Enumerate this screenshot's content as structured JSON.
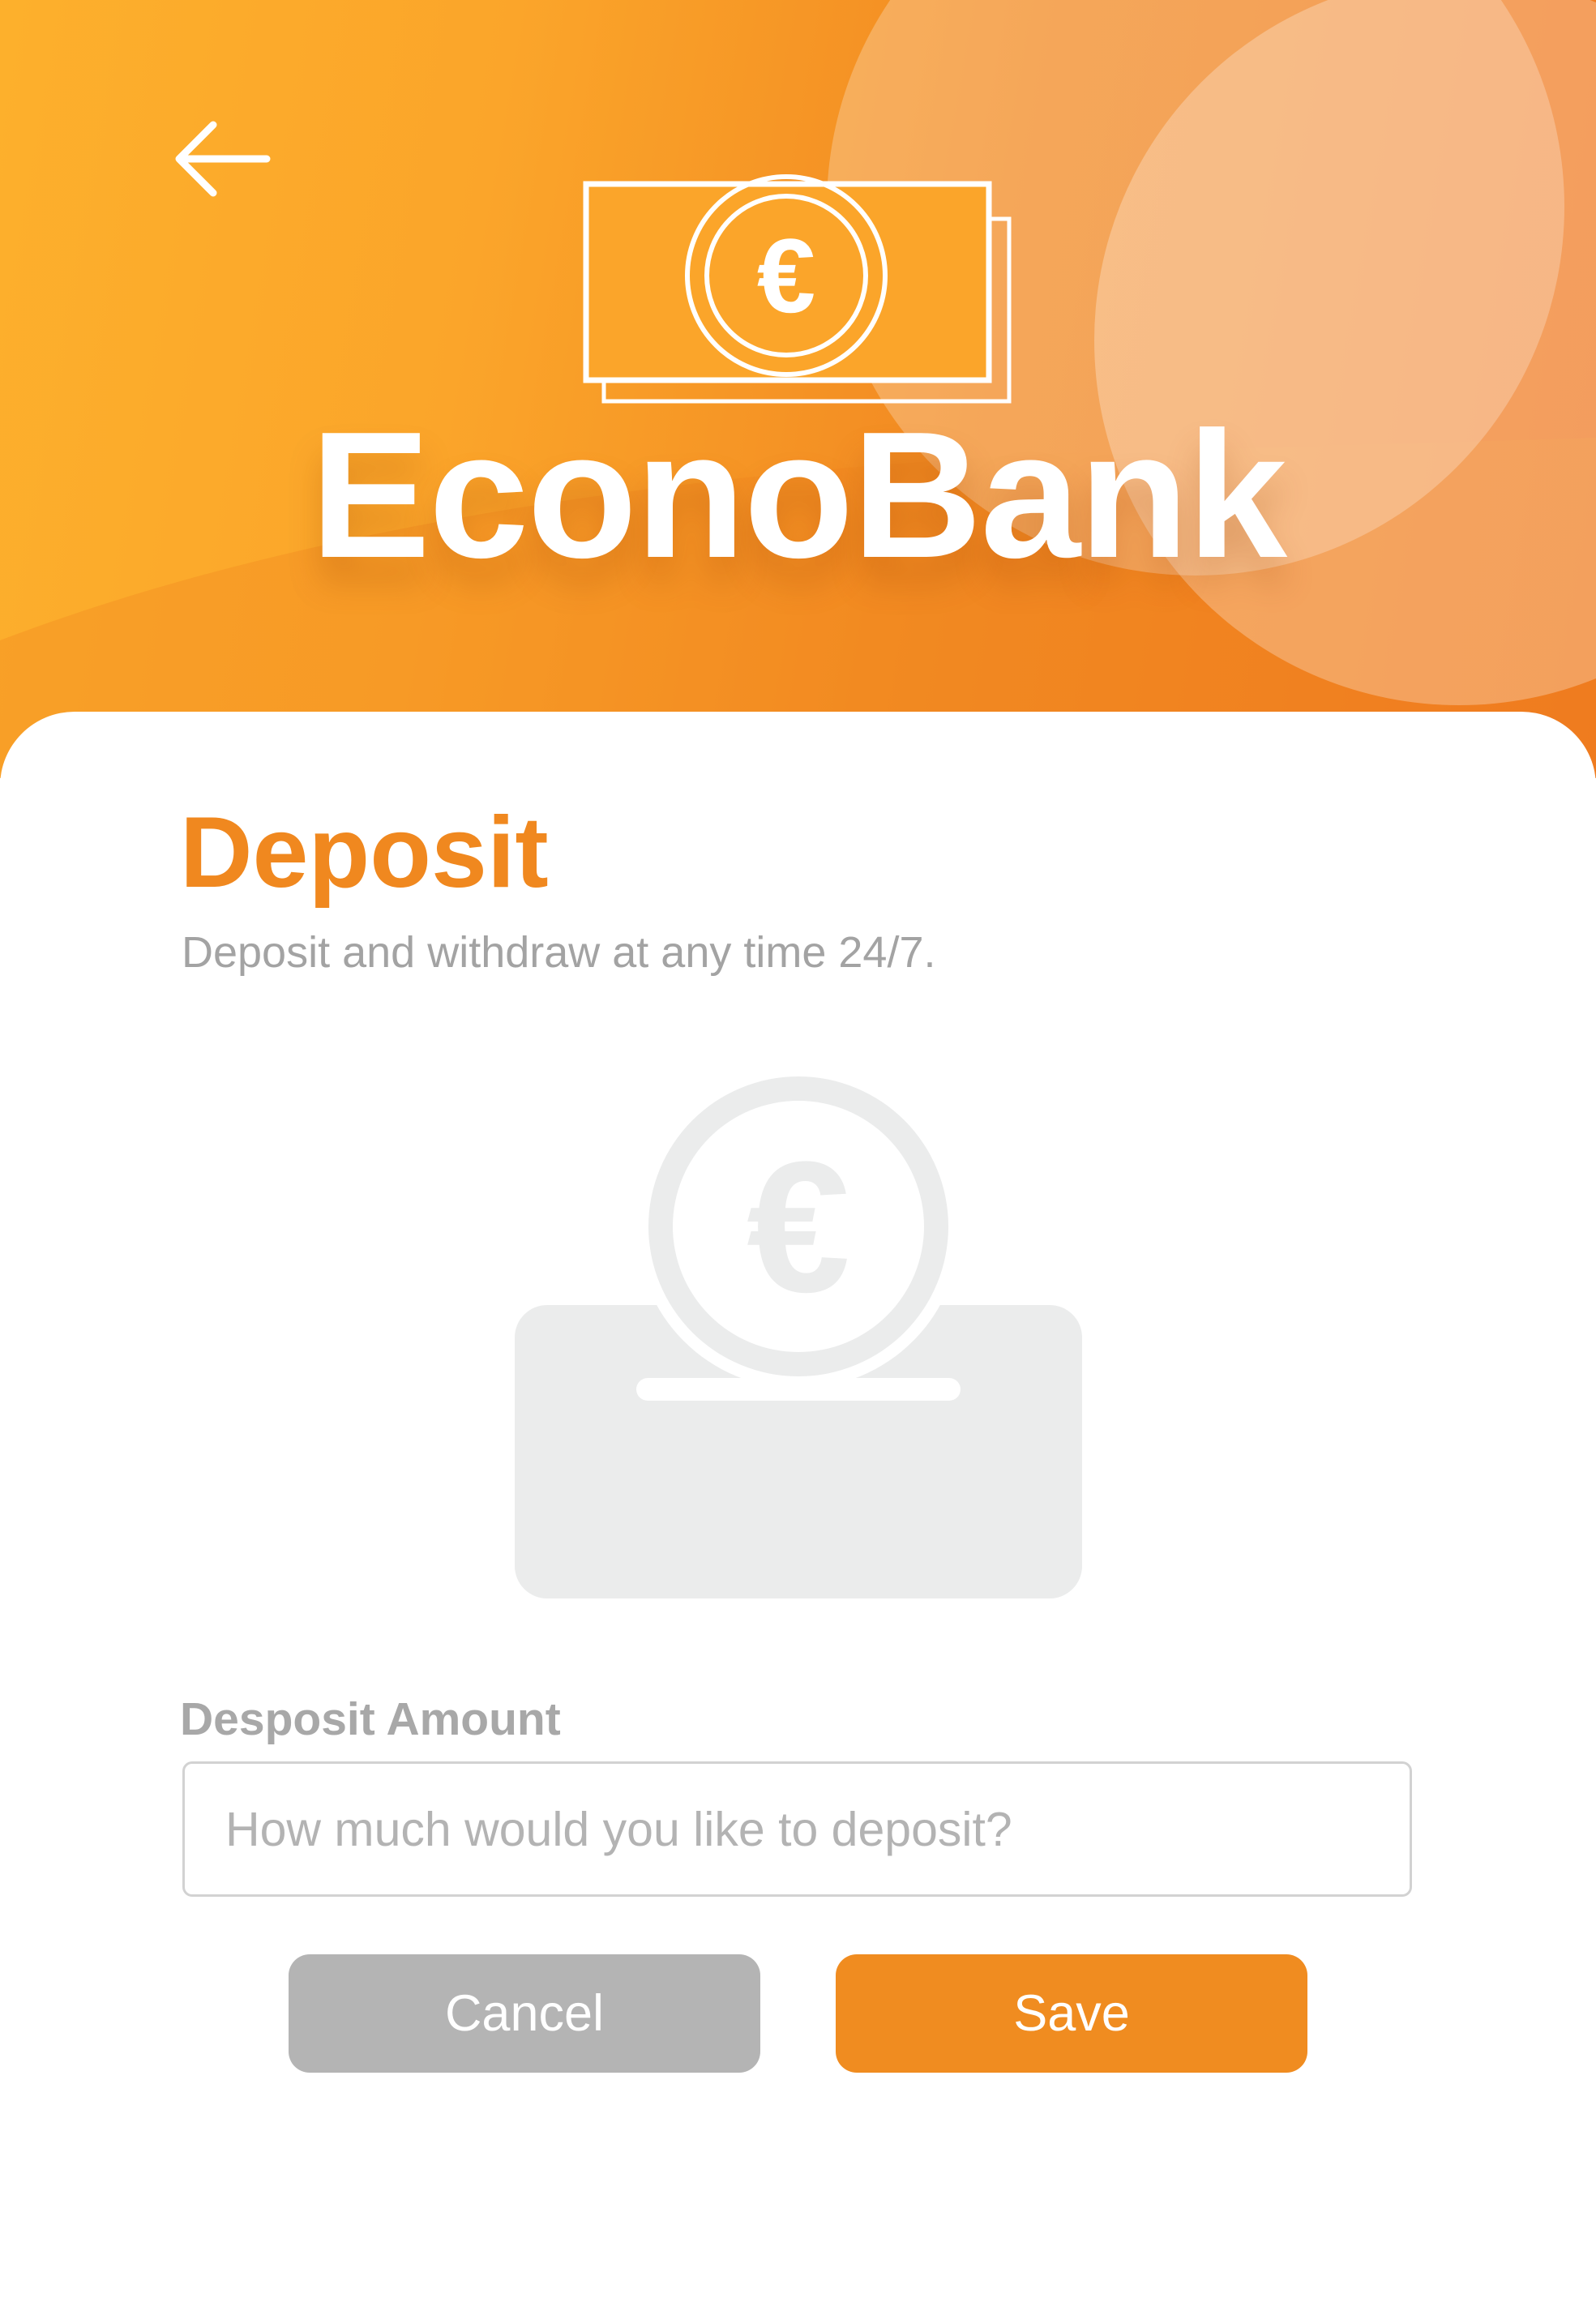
{
  "header": {
    "brand_name": "EconoBank",
    "back_icon": "arrow-left-icon",
    "logo_icon": "euro-banknote-icon"
  },
  "deposit": {
    "title": "Deposit",
    "subtitle": "Deposit and withdraw at any time 24/7.",
    "illustration_icon": "euro-coin-deposit-box-icon"
  },
  "form": {
    "amount_label": "Desposit Amount",
    "amount_value": "",
    "amount_placeholder": "How much would you like to deposit?"
  },
  "actions": {
    "cancel_label": "Cancel",
    "save_label": "Save"
  },
  "colors": {
    "accent": "#f08c20",
    "header_gradient_start": "#fdb02c",
    "header_gradient_end": "#ef7620",
    "muted_button": "#b4b4b4",
    "illustration_gray": "#ebecec"
  }
}
